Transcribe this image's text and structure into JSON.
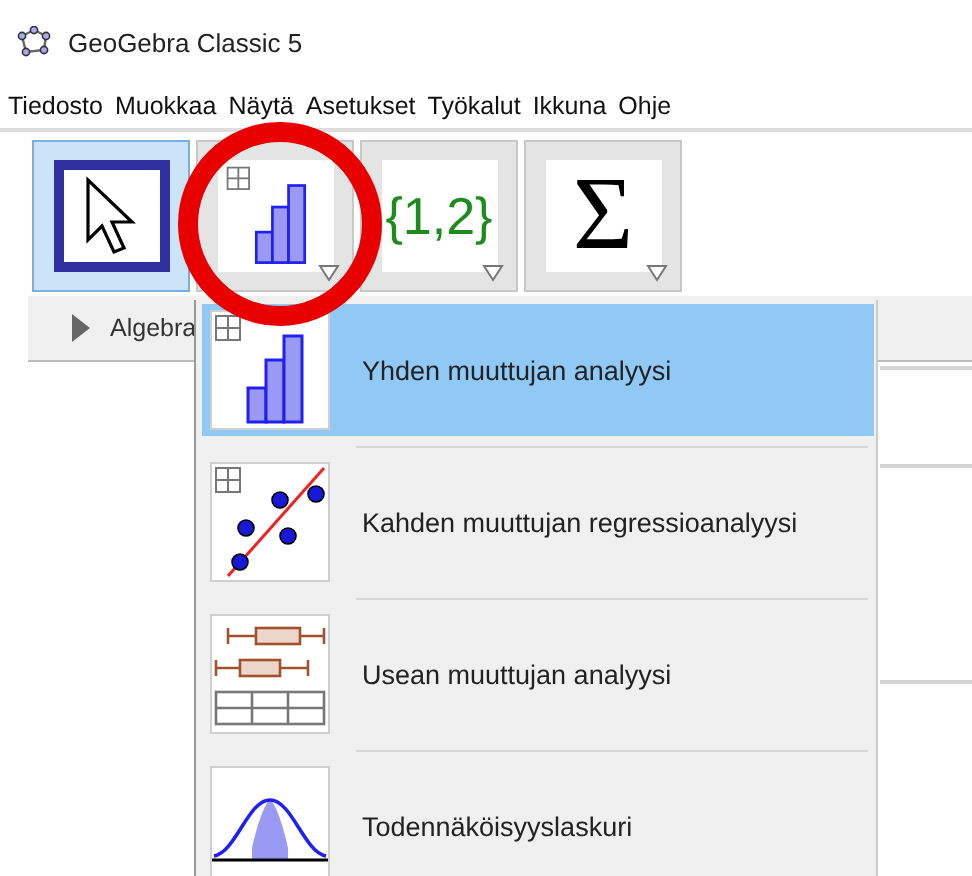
{
  "window": {
    "title": "GeoGebra Classic 5"
  },
  "menu": [
    "Tiedosto",
    "Muokkaa",
    "Näytä",
    "Asetukset",
    "Työkalut",
    "Ikkuna",
    "Ohje"
  ],
  "toolbar": [
    {
      "kind": "move",
      "selected": true,
      "has_menu": false
    },
    {
      "kind": "bars",
      "selected": false,
      "has_menu": true
    },
    {
      "kind": "list",
      "label": "{1,2}",
      "selected": false,
      "has_menu": true
    },
    {
      "kind": "sum",
      "label": "Σ",
      "selected": false,
      "has_menu": true
    }
  ],
  "algebra_header": {
    "label": "Algebra"
  },
  "dropdown": {
    "items": [
      {
        "kind": "one-variable",
        "label": "Yhden muuttujan analyysi",
        "selected": true
      },
      {
        "kind": "regression",
        "label": "Kahden muuttujan regressioanalyysi",
        "selected": false
      },
      {
        "kind": "multi-variable",
        "label": "Usean muuttujan analyysi",
        "selected": false
      },
      {
        "kind": "probability",
        "label": "Todennäköisyyslaskuri",
        "selected": false
      }
    ]
  }
}
